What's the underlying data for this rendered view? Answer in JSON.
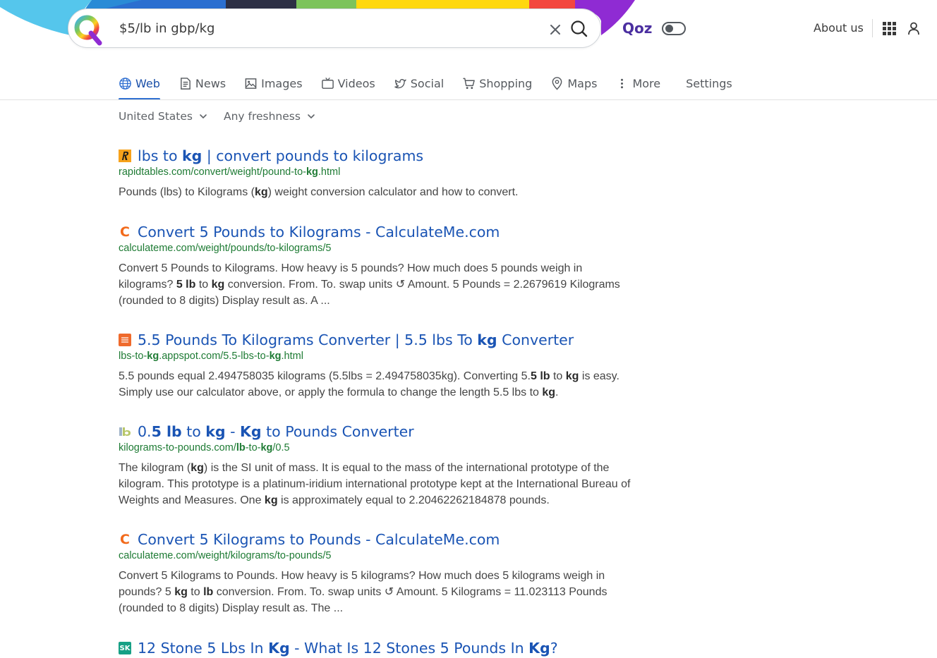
{
  "search": {
    "query": "$5/lb in gbp/kg"
  },
  "brand": {
    "qoz_label": "Qoz",
    "accent_color": "#4b2fa0"
  },
  "header": {
    "about_label": "About us"
  },
  "tabs": [
    {
      "label": "Web",
      "icon": "globe-icon",
      "active": true
    },
    {
      "label": "News",
      "icon": "newspaper-icon"
    },
    {
      "label": "Images",
      "icon": "image-icon"
    },
    {
      "label": "Videos",
      "icon": "tv-icon"
    },
    {
      "label": "Social",
      "icon": "bird-icon"
    },
    {
      "label": "Shopping",
      "icon": "cart-icon"
    },
    {
      "label": "Maps",
      "icon": "map-pin-icon"
    },
    {
      "label": "More",
      "icon": "more-vertical-icon"
    },
    {
      "label": "Settings"
    }
  ],
  "filters": {
    "region": "United States",
    "freshness": "Any freshness"
  },
  "results": [
    {
      "favicon": "rapidtables-favicon",
      "title": [
        {
          "t": "lbs to "
        },
        {
          "t": "kg",
          "b": true
        },
        {
          "t": " | convert pounds to kilograms"
        }
      ],
      "url": [
        {
          "t": "rapidtables.com/convert/weight/pound-to-"
        },
        {
          "t": "kg",
          "b": true
        },
        {
          "t": ".html"
        }
      ],
      "snippet": [
        {
          "t": "Pounds (lbs) to Kilograms ("
        },
        {
          "t": "kg",
          "b": true
        },
        {
          "t": ") weight conversion calculator and how to convert."
        }
      ]
    },
    {
      "favicon": "calculateme-favicon",
      "title": [
        {
          "t": "Convert 5 Pounds to Kilograms - CalculateMe.com"
        }
      ],
      "url": [
        {
          "t": "calculateme.com/weight/pounds/to-kilograms/5"
        }
      ],
      "snippet": [
        {
          "t": "Convert 5 Pounds to Kilograms. How heavy is 5 pounds? How much does 5 pounds weigh in kilograms? "
        },
        {
          "t": "5 lb",
          "b": true
        },
        {
          "t": " to "
        },
        {
          "t": "kg",
          "b": true
        },
        {
          "t": " conversion. From. To. swap units ↺ Amount. 5 Pounds = 2.2679619 Kilograms (rounded to 8 digits) Display result as. A ..."
        }
      ]
    },
    {
      "favicon": "lbs-to-kg-favicon",
      "title": [
        {
          "t": "5.5 Pounds To Kilograms Converter | 5.5 lbs To "
        },
        {
          "t": "kg",
          "b": true
        },
        {
          "t": " Converter"
        }
      ],
      "url": [
        {
          "t": "lbs-to-"
        },
        {
          "t": "kg",
          "b": true
        },
        {
          "t": ".appspot.com/5.5-lbs-to-"
        },
        {
          "t": "kg",
          "b": true
        },
        {
          "t": ".html"
        }
      ],
      "snippet": [
        {
          "t": "5.5 pounds equal 2.494758035 kilograms (5.5lbs = 2.494758035kg). Converting 5."
        },
        {
          "t": "5 lb",
          "b": true
        },
        {
          "t": " to "
        },
        {
          "t": "kg",
          "b": true
        },
        {
          "t": " is easy. Simply use our calculator above, or apply the formula to change the length 5.5 lbs to "
        },
        {
          "t": "kg",
          "b": true
        },
        {
          "t": "."
        }
      ]
    },
    {
      "favicon": "lb-favicon",
      "title": [
        {
          "t": "0."
        },
        {
          "t": "5 lb",
          "b": true
        },
        {
          "t": " to "
        },
        {
          "t": "kg",
          "b": true
        },
        {
          "t": " - "
        },
        {
          "t": "Kg",
          "b": true
        },
        {
          "t": " to Pounds Converter"
        }
      ],
      "url": [
        {
          "t": "kilograms-to-pounds.com/"
        },
        {
          "t": "lb",
          "b": true
        },
        {
          "t": "-to-"
        },
        {
          "t": "kg",
          "b": true
        },
        {
          "t": "/0.5"
        }
      ],
      "snippet": [
        {
          "t": "The kilogram ("
        },
        {
          "t": "kg",
          "b": true
        },
        {
          "t": ") is the SI unit of mass. It is equal to the mass of the international prototype of the kilogram. This prototype is a platinum-iridium international prototype kept at the International Bureau of Weights and Measures. One "
        },
        {
          "t": "kg",
          "b": true
        },
        {
          "t": " is approximately equal to 2.20462262184878 pounds."
        }
      ]
    },
    {
      "favicon": "calculateme-favicon",
      "title": [
        {
          "t": "Convert 5 Kilograms to Pounds - CalculateMe.com"
        }
      ],
      "url": [
        {
          "t": "calculateme.com/weight/kilograms/to-pounds/5"
        }
      ],
      "snippet": [
        {
          "t": "Convert 5 Kilograms to Pounds. How heavy is 5 kilograms? How much does 5 kilograms weigh in pounds? 5 "
        },
        {
          "t": "kg",
          "b": true
        },
        {
          "t": " to "
        },
        {
          "t": "lb",
          "b": true
        },
        {
          "t": " conversion. From. To. swap units ↺ Amount. 5 Kilograms = 11.023113 Pounds (rounded to 8 digits) Display result as. The ..."
        }
      ]
    },
    {
      "favicon": "sk-favicon",
      "title": [
        {
          "t": "12 Stone 5 Lbs In "
        },
        {
          "t": "Kg",
          "b": true
        },
        {
          "t": " - What Is 12 Stones 5 Pounds In "
        },
        {
          "t": "Kg",
          "b": true
        },
        {
          "t": "?"
        }
      ],
      "url": [],
      "snippet": []
    }
  ]
}
